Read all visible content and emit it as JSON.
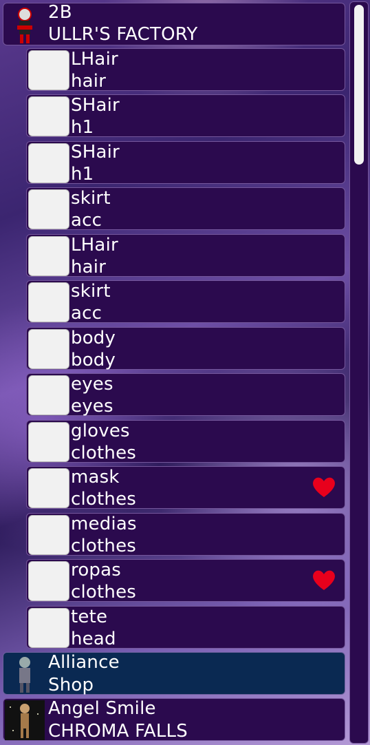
{
  "shops": [
    {
      "name": "2B",
      "location": "ULLR'S FACTORY"
    },
    {
      "name": "Alliance",
      "location": "Shop"
    },
    {
      "name": "Angel Smile",
      "location": "CHROMA FALLS"
    }
  ],
  "items": [
    {
      "name": "LHair",
      "category": "hair",
      "favorite": false
    },
    {
      "name": "SHair",
      "category": "h1",
      "favorite": false
    },
    {
      "name": "SHair",
      "category": "h1",
      "favorite": false
    },
    {
      "name": "skirt",
      "category": "acc",
      "favorite": false
    },
    {
      "name": "LHair",
      "category": "hair",
      "favorite": false
    },
    {
      "name": "skirt",
      "category": "acc",
      "favorite": false
    },
    {
      "name": "body",
      "category": "body",
      "favorite": false
    },
    {
      "name": "eyes",
      "category": "eyes",
      "favorite": false
    },
    {
      "name": "gloves",
      "category": "clothes",
      "favorite": false
    },
    {
      "name": "mask",
      "category": "clothes",
      "favorite": true
    },
    {
      "name": "medias",
      "category": "clothes",
      "favorite": false
    },
    {
      "name": "ropas",
      "category": "clothes",
      "favorite": true
    },
    {
      "name": "tete",
      "category": "head",
      "favorite": false
    }
  ],
  "colors": {
    "row_bg": "#2b0a4e",
    "selected_row_bg": "#0a2952",
    "heart": "#e8001c"
  },
  "icons": {
    "favorite": "heart-icon",
    "avatar": "avatar-icon"
  },
  "scroll": {
    "position": 0
  }
}
